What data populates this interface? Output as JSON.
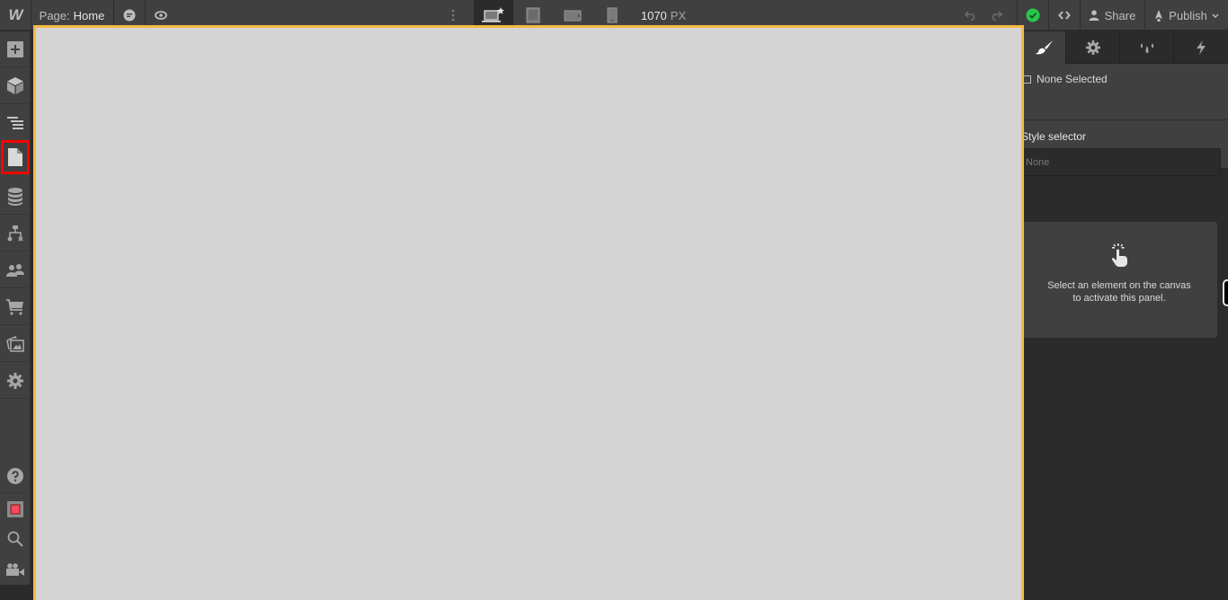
{
  "topbar": {
    "logo": "W",
    "page_prefix": "Page:",
    "page_name": "Home",
    "icons": {
      "comments": "comment-icon",
      "preview": "eye-icon",
      "more": "vertical-dots-icon"
    },
    "devices": [
      {
        "name": "desktop-star-icon",
        "active": true
      },
      {
        "name": "tablet-icon",
        "active": false
      },
      {
        "name": "mobile-landscape-icon",
        "active": false
      },
      {
        "name": "mobile-portrait-icon",
        "active": false
      }
    ],
    "width_value": "1070",
    "width_unit": "PX",
    "undo_icon": "undo-icon",
    "redo_icon": "redo-icon",
    "status_icon": "check-circle-icon",
    "status_color": "#27c84a",
    "code_icon": "code-brackets-icon",
    "share_label": "Share",
    "publish_label": "Publish"
  },
  "leftbar": {
    "items": [
      {
        "name": "add-icon",
        "label": "Add"
      },
      {
        "name": "cube-icon",
        "label": "Symbols"
      },
      {
        "name": "navigator-icon",
        "label": "Navigator"
      },
      {
        "name": "pages-icon",
        "label": "Pages",
        "highlighted": true
      },
      {
        "name": "database-icon",
        "label": "CMS"
      },
      {
        "name": "logic-flow-icon",
        "label": "Logic"
      },
      {
        "name": "users-icon",
        "label": "Users"
      },
      {
        "name": "cart-icon",
        "label": "Ecommerce"
      },
      {
        "name": "assets-icon",
        "label": "Assets"
      },
      {
        "name": "gear-icon",
        "label": "Settings"
      }
    ],
    "bottom_items": [
      {
        "name": "help-icon",
        "label": "Help"
      },
      {
        "name": "record-icon",
        "label": "Audit"
      },
      {
        "name": "search-icon",
        "label": "Search"
      },
      {
        "name": "video-icon",
        "label": "Video tutorials"
      }
    ]
  },
  "rightpanel": {
    "tabs": [
      {
        "name": "style-brush-icon",
        "active": true
      },
      {
        "name": "settings-gear-icon",
        "active": false
      },
      {
        "name": "style-manager-drops-icon",
        "active": false
      },
      {
        "name": "interactions-bolt-icon",
        "active": false
      }
    ],
    "selection_label": "None Selected",
    "style_selector_label": "Style selector",
    "style_selector_placeholder": "None",
    "empty_message_line1": "Select an element on the canvas",
    "empty_message_line2": "to activate this panel."
  },
  "colors": {
    "accent_canvas_border": "#f5b942",
    "highlight": "#ff0000"
  }
}
